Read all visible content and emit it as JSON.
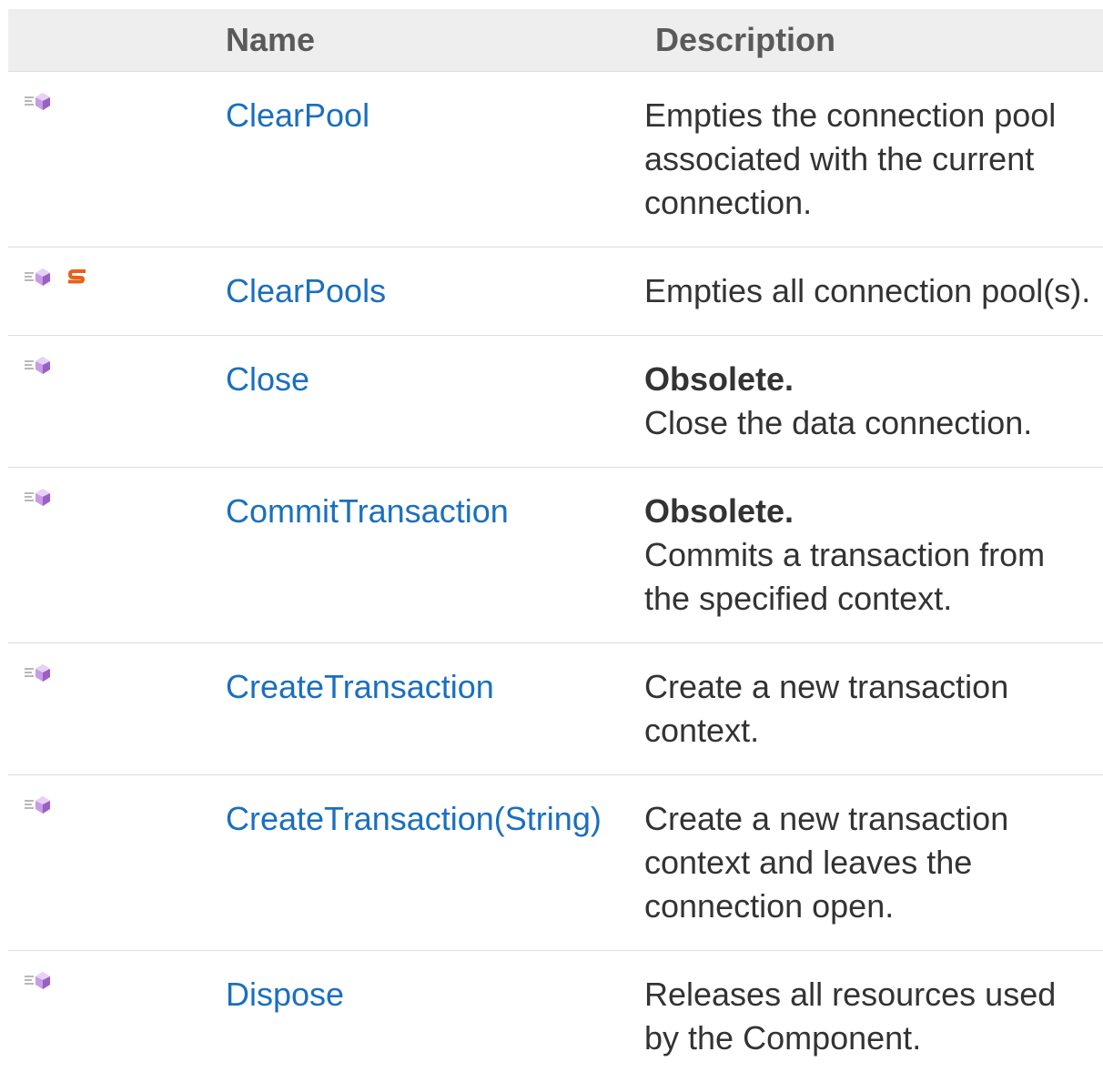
{
  "header": {
    "icons": "",
    "name": "Name",
    "description": "Description"
  },
  "icons": {
    "method": "public-method-icon",
    "static": "static-member-icon"
  },
  "colors": {
    "link": "#1a6fbf",
    "header_bg": "#eeeeee",
    "static_badge": "#e8611a",
    "method_icon": "#b07fd6"
  },
  "rows": [
    {
      "name": "ClearPool",
      "is_static": false,
      "obsolete": "",
      "description": "Empties the connection pool associated with the current connection."
    },
    {
      "name": "ClearPools",
      "is_static": true,
      "obsolete": "",
      "description": "Empties all connection pool(s)."
    },
    {
      "name": "Close",
      "is_static": false,
      "obsolete": "Obsolete.",
      "description": "Close the data connection."
    },
    {
      "name": "CommitTransaction",
      "is_static": false,
      "obsolete": "Obsolete.",
      "description": "Commits a transaction from the specified context."
    },
    {
      "name": "CreateTransaction",
      "is_static": false,
      "obsolete": "",
      "description": "Create a new transaction context."
    },
    {
      "name": "CreateTransaction(String)",
      "is_static": false,
      "obsolete": "",
      "description": "Create a new transaction context and leaves the connection open."
    },
    {
      "name": "Dispose",
      "is_static": false,
      "obsolete": "",
      "description": "Releases all resources used by the Component."
    }
  ]
}
